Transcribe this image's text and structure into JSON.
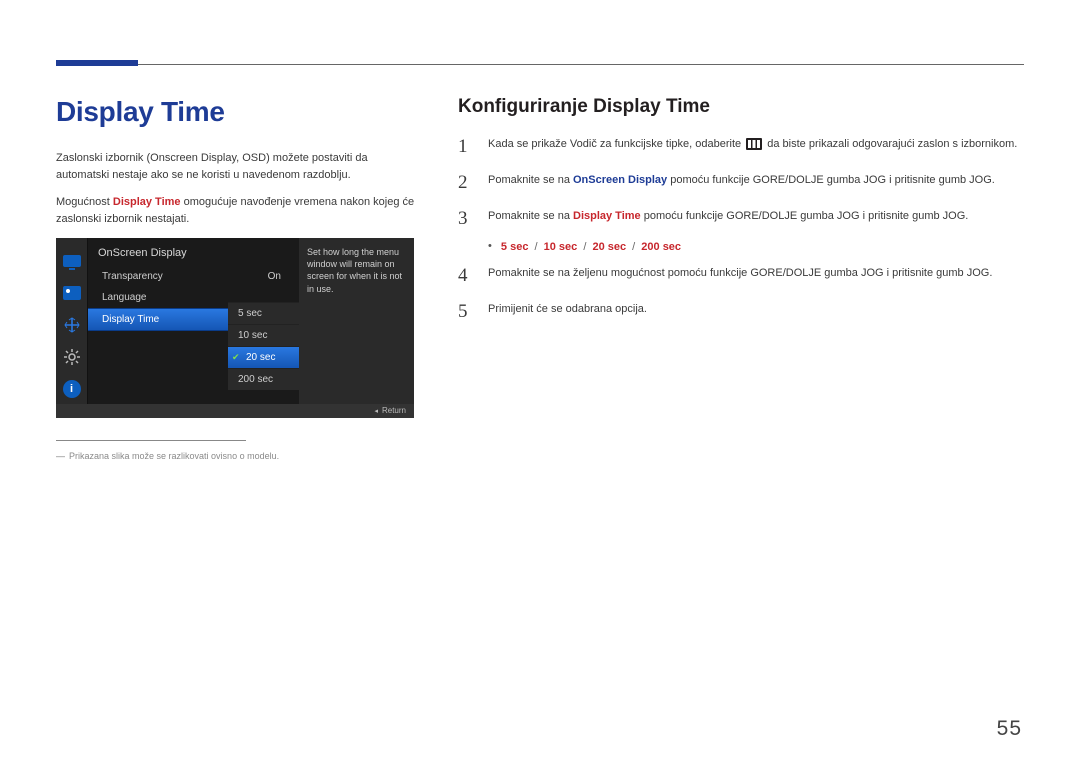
{
  "page_number": "55",
  "left": {
    "title": "Display Time",
    "intro1_a": "Zaslonski izbornik (Onscreen Display, OSD) možete postaviti da automatski nestaje ako se ne koristi u navedenom razdoblju.",
    "intro2_a": "Mogućnost ",
    "intro2_red": "Display Time",
    "intro2_b": " omogućuje navođenje vremena nakon kojeg će zaslonski izbornik nestajati.",
    "footnote_dash": "―",
    "footnote": "Prikazana slika može se razlikovati ovisno o modelu."
  },
  "osd": {
    "title": "OnScreen Display",
    "rows": {
      "transparency": {
        "label": "Transparency",
        "value": "On"
      },
      "language": {
        "label": "Language",
        "value": ""
      },
      "display_time": {
        "label": "Display Time",
        "value": ""
      }
    },
    "options": {
      "o1": "5 sec",
      "o2": "10 sec",
      "o3": "20 sec",
      "o4": "200 sec"
    },
    "desc": "Set how long the menu window will remain on screen for when it is not in use.",
    "return": "Return"
  },
  "right": {
    "title": "Konfiguriranje Display Time",
    "steps": {
      "n1": "1",
      "n2": "2",
      "n3": "3",
      "n4": "4",
      "n5": "5",
      "s1_a": "Kada se prikaže Vodič za funkcijske tipke, odaberite ",
      "s1_b": " da biste prikazali odgovarajući zaslon s izbornikom.",
      "s2_a": "Pomaknite se na ",
      "s2_blue": "OnScreen Display",
      "s2_b": " pomoću funkcije GORE/DOLJE gumba JOG i pritisnite gumb JOG.",
      "s3_a": "Pomaknite se na ",
      "s3_red": "Display Time",
      "s3_b": " pomoću funkcije GORE/DOLJE gumba JOG i pritisnite gumb JOG.",
      "options": {
        "o1": "5 sec",
        "o2": "10 sec",
        "o3": "20 sec",
        "o4": "200 sec"
      },
      "s4": "Pomaknite se na željenu mogućnost pomoću funkcije GORE/DOLJE gumba JOG i pritisnite gumb JOG.",
      "s5": "Primijenit će se odabrana opcija."
    }
  }
}
